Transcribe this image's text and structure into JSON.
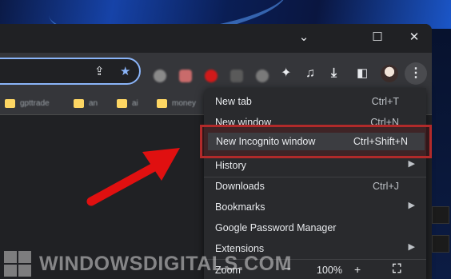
{
  "window": {
    "controls": {
      "minimize": "⌄",
      "maximize": "☐",
      "close": "✕"
    }
  },
  "omnibox": {
    "share_icon": "share-icon",
    "star_icon": "star-icon"
  },
  "toolbar": {
    "icons": [
      "extensions-icon",
      "media-control-icon",
      "download-icon",
      "side-panel-icon",
      "profile-avatar",
      "menu-icon"
    ]
  },
  "bookmarks": [
    "gpttrade",
    "an",
    "ai",
    "money"
  ],
  "menu": {
    "items": [
      {
        "label": "New tab",
        "shortcut": "Ctrl+T"
      },
      {
        "label": "New window",
        "shortcut": "Ctrl+N"
      },
      {
        "label": "New Incognito window",
        "shortcut": "Ctrl+Shift+N"
      },
      {
        "label": "History",
        "shortcut": ""
      },
      {
        "label": "Downloads",
        "shortcut": "Ctrl+J"
      },
      {
        "label": "Bookmarks",
        "shortcut": ""
      },
      {
        "label": "Google Password Manager",
        "shortcut": ""
      },
      {
        "label": "Extensions",
        "shortcut": ""
      }
    ],
    "zoom": {
      "label": "Zoom",
      "minus": "−",
      "value": "100%",
      "plus": "+"
    }
  },
  "watermark": {
    "text": "WINDOWSDIGITALS.COM"
  },
  "colors": {
    "highlight": "#b12a2a",
    "arrow": "#e01010",
    "accent": "#8ab4f8"
  }
}
